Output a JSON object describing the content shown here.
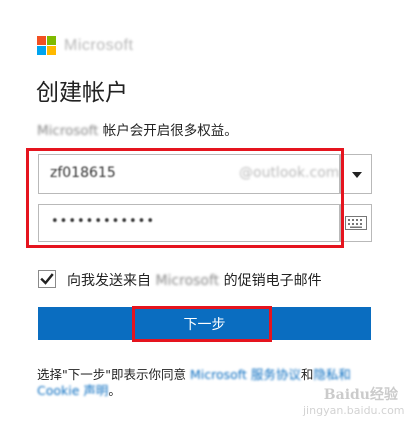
{
  "brand": {
    "name": "Microsoft",
    "colors": [
      "#f25022",
      "#7fba00",
      "#00a4ef",
      "#ffb900"
    ]
  },
  "page": {
    "title": "创建帐户",
    "subtitle_brand": "Microsoft",
    "subtitle_text": " 帐户会开启很多权益。"
  },
  "email": {
    "value": "zf018615",
    "domain": "@outlook.com"
  },
  "password": {
    "masked": "••••••••••••"
  },
  "icons": {
    "dropdown": "chevron-down-icon",
    "keyboard": "keyboard-icon",
    "check": "check-icon"
  },
  "promo_checkbox": {
    "checked": true,
    "label_prefix": "向我发送来自 ",
    "label_brand": "Microsoft",
    "label_suffix": " 的促销电子邮件"
  },
  "next_button": {
    "label": "下一步"
  },
  "terms": {
    "prefix": "选择\"下一步\"即表示你同意 ",
    "link1": "Microsoft 服务协议",
    "middle": "和",
    "link2": "隐私和 Cookie 声明",
    "suffix": "。"
  },
  "highlight_color": "#e5141e",
  "accent_color": "#0a6dc0",
  "watermark": {
    "main": "Baidu经验",
    "url": "jingyan.baidu.com"
  }
}
